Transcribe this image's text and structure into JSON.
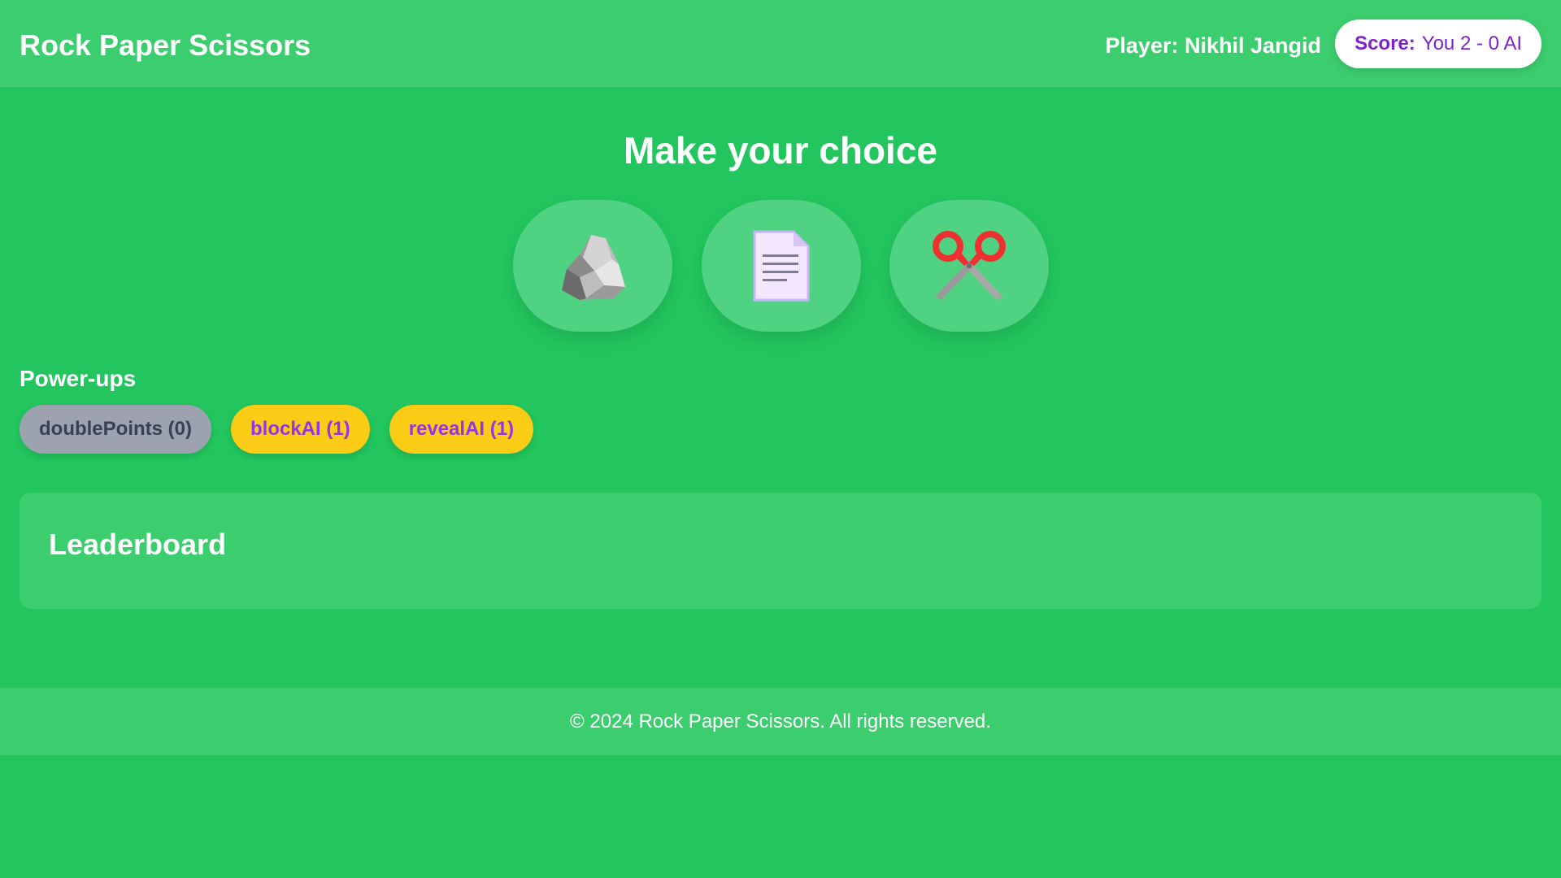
{
  "header": {
    "title": "Rock Paper Scissors",
    "player": "Player: Nikhil Jangid",
    "score_label": "Score:",
    "score_value": "You 2 - 0 AI"
  },
  "main": {
    "heading": "Make your choice",
    "choices": [
      {
        "name": "rock",
        "icon": "rock-icon"
      },
      {
        "name": "paper",
        "icon": "paper-icon"
      },
      {
        "name": "scissors",
        "icon": "scissors-icon"
      }
    ]
  },
  "powerups": {
    "title": "Power-ups",
    "items": [
      {
        "label": "doublePoints (0)",
        "state": "disabled"
      },
      {
        "label": "blockAI (1)",
        "state": "active"
      },
      {
        "label": "revealAI (1)",
        "state": "active"
      }
    ]
  },
  "leaderboard": {
    "title": "Leaderboard"
  },
  "footer": {
    "text": "© 2024 Rock Paper Scissors. All rights reserved."
  },
  "colors": {
    "background": "#22c55e",
    "panel": "#3ccd6f",
    "score_text": "#7e22ce",
    "powerup_active": "#facc15",
    "powerup_active_text": "#9333ea",
    "powerup_disabled": "#9ca3af"
  }
}
